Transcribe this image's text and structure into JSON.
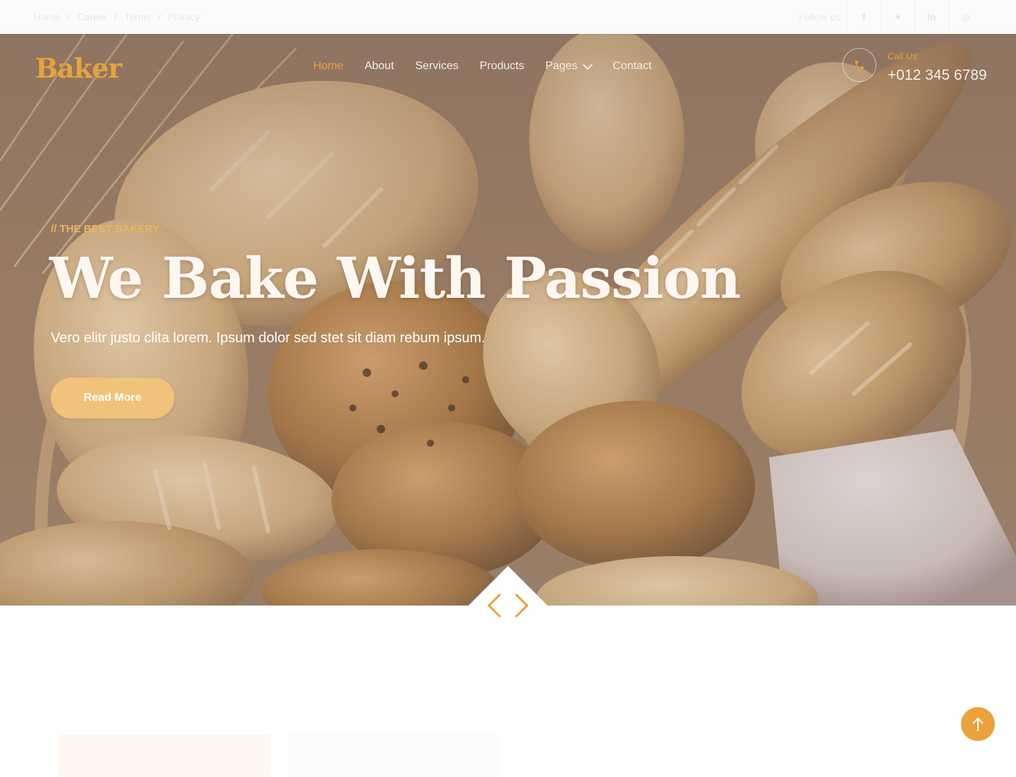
{
  "topbar": {
    "breadcrumbs": [
      "Home",
      "Career",
      "Terms",
      "Privacy"
    ],
    "follow_label": "Follow us:",
    "social": [
      {
        "icon": "facebook-icon",
        "glyph": "f"
      },
      {
        "icon": "twitter-icon",
        "glyph": "✦"
      },
      {
        "icon": "linkedin-icon",
        "glyph": "in"
      },
      {
        "icon": "instagram-icon",
        "glyph": "◎"
      }
    ]
  },
  "header": {
    "logo": "Baker",
    "nav": [
      {
        "label": "Home",
        "active": true
      },
      {
        "label": "About"
      },
      {
        "label": "Services"
      },
      {
        "label": "Products"
      },
      {
        "label": "Pages",
        "dropdown": true
      },
      {
        "label": "Contact"
      }
    ],
    "call_label": "Call Us",
    "phone": "+012 345 6789"
  },
  "hero": {
    "tagline": "// THE BEST BAKERY",
    "headline": "We Bake With Passion",
    "subtitle": "Vero elitr justo clita lorem. Ipsum dolor sed stet sit diam rebum ipsum.",
    "button": "Read More"
  },
  "colors": {
    "accent": "#eaa23a",
    "button": "#f1c27b",
    "hero_text": "#fdf7f2"
  }
}
